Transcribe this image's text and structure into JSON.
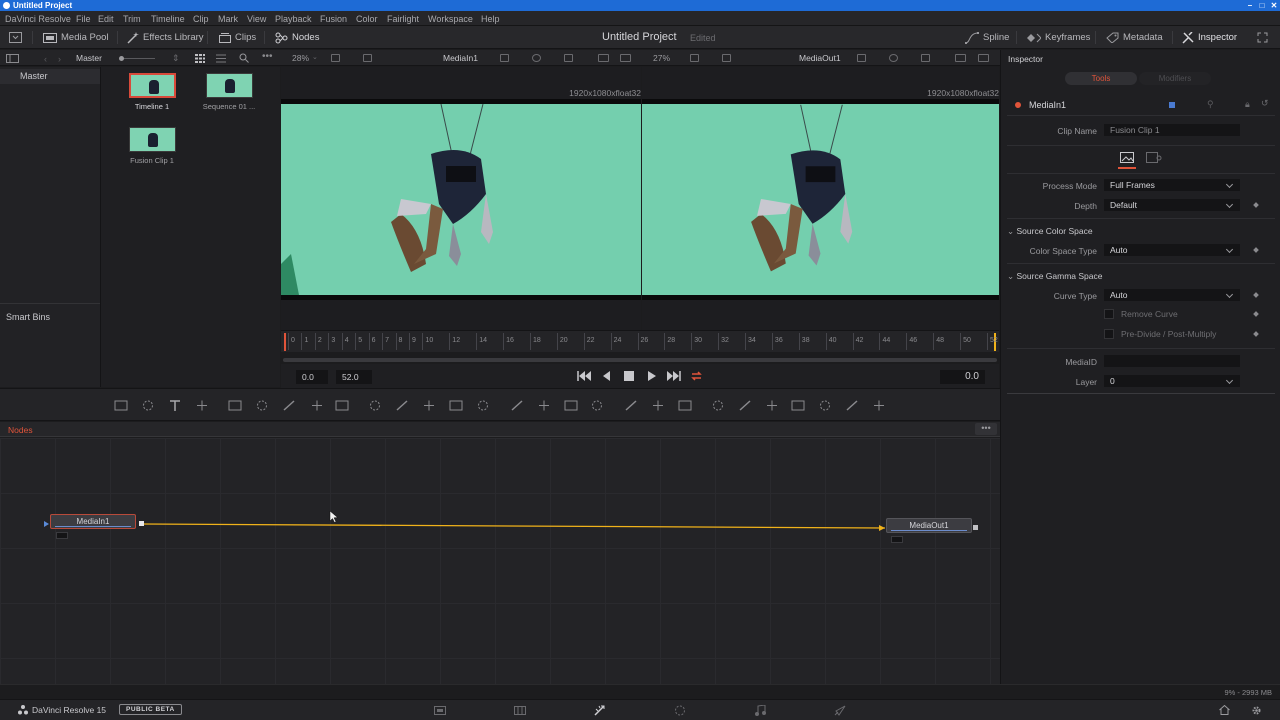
{
  "window": {
    "title": "Untitled Project"
  },
  "menu": [
    "DaVinci Resolve",
    "File",
    "Edit",
    "Trim",
    "Timeline",
    "Clip",
    "Mark",
    "View",
    "Playback",
    "Fusion",
    "Color",
    "Fairlight",
    "Workspace",
    "Help"
  ],
  "toolbar": {
    "media_pool": "Media Pool",
    "effects_library": "Effects Library",
    "clips": "Clips",
    "nodes": "Nodes",
    "project_title": "Untitled Project",
    "project_status": "Edited",
    "spline": "Spline",
    "keyframes": "Keyframes",
    "metadata": "Metadata",
    "inspector": "Inspector"
  },
  "subbar": {
    "bin": "Master",
    "left_zoom": "28%",
    "left_viewer": "MediaIn1",
    "right_zoom": "27%",
    "right_viewer": "MediaOut1",
    "inspector_title": "Inspector"
  },
  "media_pool": {
    "bins": {
      "master": "Master",
      "smart_bins": "Smart Bins"
    },
    "clips": [
      {
        "name": "Timeline 1",
        "selected": true
      },
      {
        "name": "Sequence 01 ...",
        "selected": false
      },
      {
        "name": "Fusion Clip 1",
        "selected": false
      }
    ]
  },
  "viewers": {
    "left_resolution": "1920x1080xfloat32",
    "right_resolution": "1920x1080xfloat32"
  },
  "ruler": {
    "ticks": [
      "0",
      "1",
      "2",
      "3",
      "4",
      "5",
      "6",
      "7",
      "8",
      "9",
      "10",
      "12",
      "14",
      "16",
      "18",
      "20",
      "22",
      "24",
      "26",
      "28",
      "30",
      "32",
      "34",
      "36",
      "38",
      "40",
      "42",
      "44",
      "46",
      "48",
      "50",
      "52"
    ]
  },
  "transport": {
    "in": "0.0",
    "out": "52.0",
    "current": "0.0"
  },
  "nodes_panel": {
    "title": "Nodes",
    "nodes": [
      {
        "name": "MediaIn1"
      },
      {
        "name": "MediaOut1"
      }
    ]
  },
  "inspector": {
    "tabs": {
      "tools": "Tools",
      "modifiers": "Modifiers"
    },
    "node_name": "MediaIn1",
    "clip_name_label": "Clip Name",
    "clip_name_value": "Fusion Clip 1",
    "process_mode_label": "Process Mode",
    "process_mode_value": "Full Frames",
    "depth_label": "Depth",
    "depth_value": "Default",
    "source_color_space": "Source Color Space",
    "color_space_type_label": "Color Space Type",
    "color_space_type_value": "Auto",
    "source_gamma_space": "Source Gamma Space",
    "curve_type_label": "Curve Type",
    "curve_type_value": "Auto",
    "remove_curve": "Remove Curve",
    "pre_divide": "Pre-Divide / Post-Multiply",
    "media_id_label": "MediaID",
    "media_id_value": "",
    "layer_label": "Layer",
    "layer_value": "0"
  },
  "status": {
    "right": "9% - 2993 MB"
  },
  "bottom": {
    "app_name": "DaVinci Resolve 15",
    "badge": "PUBLIC BETA"
  },
  "colors": {
    "accent_red": "#e0543a",
    "link_yellow": "#f0b21a",
    "green_screen": "#74cfae",
    "selection_blue": "#1e6bd6"
  }
}
